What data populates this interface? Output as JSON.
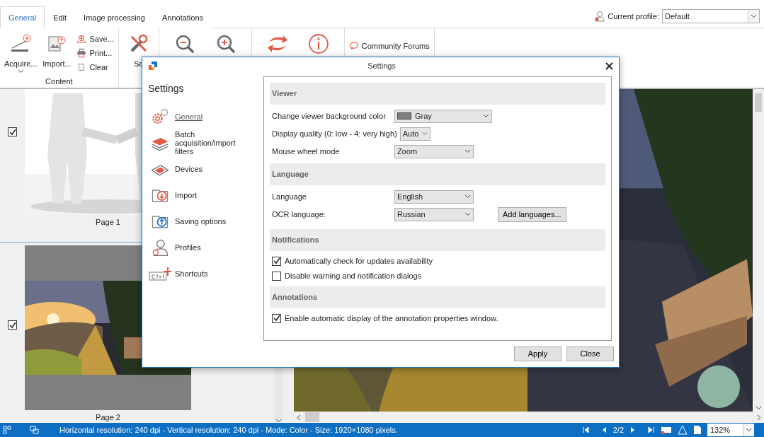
{
  "ribbon": {
    "tabs": [
      {
        "label": "General",
        "selected": true
      },
      {
        "label": "Edit",
        "selected": false
      },
      {
        "label": "Image processing",
        "selected": false
      },
      {
        "label": "Annotations",
        "selected": false
      }
    ],
    "profile": {
      "label": "Current profile:",
      "value": "Default"
    },
    "groups": [
      {
        "label": "Content",
        "buttons": [
          {
            "kind": "large",
            "label": "Acquire..."
          },
          {
            "kind": "large",
            "label": "Import..."
          },
          {
            "kind": "small",
            "label": "Save..."
          },
          {
            "kind": "small",
            "label": "Print..."
          },
          {
            "kind": "small",
            "label": "Clear"
          }
        ]
      },
      {
        "buttons": [
          {
            "kind": "large",
            "label": "Se"
          }
        ]
      },
      {
        "buttons": [
          {
            "kind": "large"
          },
          {
            "kind": "large"
          }
        ]
      },
      {
        "buttons": [
          {
            "kind": "large"
          },
          {
            "kind": "large"
          }
        ]
      },
      {
        "buttons": [
          {
            "kind": "small",
            "label": "Community Forums"
          }
        ]
      }
    ]
  },
  "thumbnails": [
    {
      "label": "Page 1",
      "checked": true
    },
    {
      "label": "Page 2",
      "checked": true
    }
  ],
  "dialog": {
    "title": "Settings",
    "heading": "Settings",
    "nav": [
      {
        "label": "General",
        "selected": true
      },
      {
        "label": "Batch acquisition/import filters",
        "selected": false
      },
      {
        "label": "Devices",
        "selected": false
      },
      {
        "label": "Import",
        "selected": false
      },
      {
        "label": "Saving options",
        "selected": false
      },
      {
        "label": "Profiles",
        "selected": false
      },
      {
        "label": "Shortcuts",
        "selected": false
      }
    ],
    "sections": [
      {
        "title": "Viewer",
        "rows": [
          {
            "kind": "select",
            "label": "Change viewer background color",
            "value": "Gray"
          },
          {
            "kind": "select",
            "label": "Display quality (0: low - 4: very high)",
            "value": "Auto"
          },
          {
            "kind": "select",
            "label": "Mouse wheel mode",
            "value": "Zoom"
          }
        ]
      },
      {
        "title": "Language",
        "rows": [
          {
            "kind": "select",
            "label": "Language",
            "value": "English"
          },
          {
            "kind": "select",
            "label": "OCR language:",
            "value": "Russian",
            "button": "Add languages..."
          }
        ]
      },
      {
        "title": "Notifications",
        "rows": [
          {
            "kind": "check",
            "label": "Automatically check for updates availability",
            "checked": true
          },
          {
            "kind": "check",
            "label": "Disable warning and notification dialogs",
            "checked": false
          }
        ]
      },
      {
        "title": "Annotations",
        "rows": [
          {
            "kind": "check",
            "label": "Enable automatic display of the annotation properties window.",
            "checked": true
          }
        ]
      }
    ],
    "buttons": [
      "Apply",
      "Close"
    ]
  },
  "status_bar": {
    "text": "Horizontal resolution:  240 dpi - Vertical resolution:  240 dpi - Mode: Color - Size: 1920×1080 pixels.",
    "page": "2/2",
    "zoom": "132%"
  }
}
